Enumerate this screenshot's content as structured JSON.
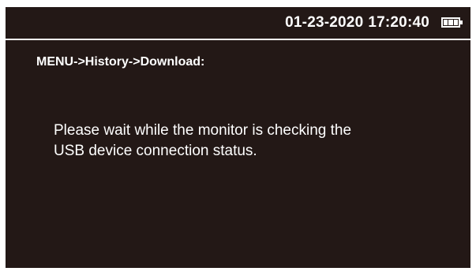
{
  "status_bar": {
    "date": "01-23-2020",
    "time": "17:20:40",
    "battery_icon": "battery-icon",
    "battery_level_bars": 3,
    "battery_capacity_bars": 3
  },
  "breadcrumb": "MENU->History->Download:",
  "message": {
    "line1": "Please wait while the monitor is checking the",
    "line2": "USB device connection status."
  },
  "colors": {
    "screen_background": "#231816",
    "foreground": "#ffffff",
    "page_background": "#ffffff"
  }
}
